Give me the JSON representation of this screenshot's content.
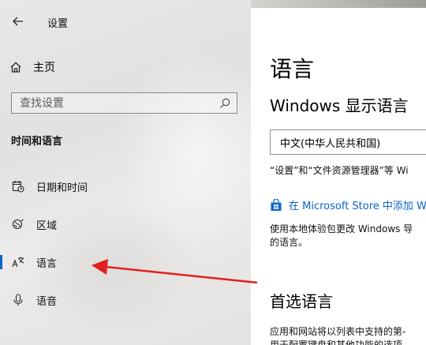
{
  "window": {
    "title": "设置"
  },
  "sidebar": {
    "home_label": "主页",
    "search_placeholder": "查找设置",
    "section_heading": "时间和语言",
    "items": [
      {
        "label": "日期和时间",
        "icon": "calendar-clock-icon"
      },
      {
        "label": "区域",
        "icon": "globe-region-icon"
      },
      {
        "label": "语言",
        "icon": "language-icon",
        "selected": true
      },
      {
        "label": "语音",
        "icon": "microphone-icon"
      }
    ]
  },
  "main": {
    "title": "语言",
    "display_language_heading": "Windows 显示语言",
    "display_language_value": "中文(中华人民共和国)",
    "display_language_note": "“设置”和“文件资源管理器”等 Wi",
    "store_link": "在 Microsoft Store 中添加 W",
    "store_desc_line1": "使用本地体验包更改 Windows 导",
    "store_desc_line2": "的语言。",
    "preferred_heading": "首选语言",
    "preferred_desc_line1": "应用和网站将以列表中支持的第-",
    "preferred_desc_line2": "用于配置键盘和其他功能的选项"
  },
  "colors": {
    "accent": "#0a64c8",
    "annotation_arrow": "#e02020",
    "sidebar_bg": "#e6e5e3"
  }
}
